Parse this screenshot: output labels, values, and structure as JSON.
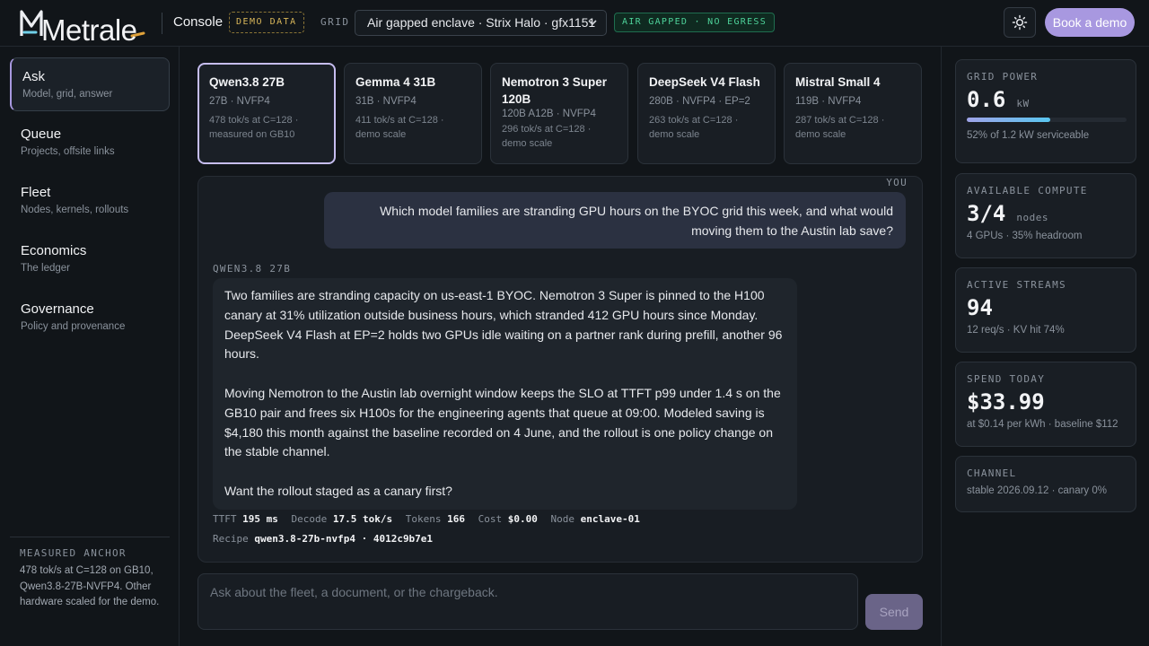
{
  "brand": {
    "name": "Metrale",
    "accent": "#a898e0"
  },
  "header": {
    "console_label": "Console",
    "demo_badge": "DEMO DATA",
    "grid_label": "GRID",
    "grid_selected": "Air gapped enclave · Strix Halo · gfx1151",
    "airgap_badge": "AIR GAPPED · NO EGRESS",
    "book_demo": "Book a demo",
    "theme_icon": "sun-icon"
  },
  "nav": {
    "items": [
      {
        "title": "Ask",
        "sub": "Model, grid, answer",
        "active": true
      },
      {
        "title": "Queue",
        "sub": "Projects, offsite links"
      },
      {
        "title": "Fleet",
        "sub": "Nodes, kernels, rollouts"
      },
      {
        "title": "Economics",
        "sub": "The ledger"
      },
      {
        "title": "Governance",
        "sub": "Policy and provenance"
      }
    ],
    "anchor": {
      "title": "MEASURED ANCHOR",
      "text": "478 tok/s at C=128 on GB10, Qwen3.8-27B-NVFP4. Other hardware scaled for the demo."
    }
  },
  "models": [
    {
      "name": "Qwen3.8 27B",
      "spec": "27B · NVFP4",
      "rate": "478 tok/s at C=128 · measured on GB10",
      "selected": true
    },
    {
      "name": "Gemma 4 31B",
      "spec": "31B · NVFP4",
      "rate": "411 tok/s at C=128 · demo scale"
    },
    {
      "name": "Nemotron 3 Super 120B",
      "spec": "120B A12B · NVFP4",
      "rate": "296 tok/s at C=128 · demo scale"
    },
    {
      "name": "DeepSeek V4 Flash",
      "spec": "280B · NVFP4 · EP=2",
      "rate": "263 tok/s at C=128 · demo scale"
    },
    {
      "name": "Mistral Small 4",
      "spec": "119B · NVFP4",
      "rate": "287 tok/s at C=128 · demo scale"
    }
  ],
  "chat": {
    "you_label": "YOU",
    "user_message": "Which model families are stranding GPU hours on the BYOC grid this week, and what would moving them to the Austin lab save?",
    "model_label": "QWEN3.8 27B",
    "answer": [
      "Two families are stranding capacity on us-east-1 BYOC. Nemotron 3 Super is pinned to the H100 canary at 31% utilization outside business hours, which stranded 412 GPU hours since Monday. DeepSeek V4 Flash at EP=2 holds two GPUs idle waiting on a partner rank during prefill, another 96 hours.",
      "Moving Nemotron to the Austin lab overnight window keeps the SLO at TTFT p99 under 1.4 s on the GB10 pair and frees six H100s for the engineering agents that queue at 09:00. Modeled saving is $4,180 this month against the baseline recorded on 4 June, and the rollout is one policy change on the stable channel.",
      "Want the rollout staged as a canary first?"
    ],
    "metrics": {
      "ttft_label": "TTFT",
      "ttft": "195 ms",
      "decode_label": "Decode",
      "decode": "17.5 tok/s",
      "tokens_label": "Tokens",
      "tokens": "166",
      "cost_label": "Cost",
      "cost": "$0.00",
      "node_label": "Node",
      "node": "enclave-01",
      "recipe_label": "Recipe",
      "recipe": "qwen3.8-27b-nvfp4 · 4012c9b7e1"
    }
  },
  "composer": {
    "placeholder": "Ask about the fleet, a document, or the chargeback.",
    "send_label": "Send"
  },
  "stats": {
    "power": {
      "title": "GRID POWER",
      "value": "0.6",
      "unit": "kW",
      "sub": "52% of 1.2 kW serviceable",
      "fraction": 0.52
    },
    "compute": {
      "title": "AVAILABLE COMPUTE",
      "value": "3/4",
      "unit": "nodes",
      "sub": "4 GPUs · 35% headroom"
    },
    "streams": {
      "title": "ACTIVE STREAMS",
      "value": "94",
      "sub": "12 req/s · KV hit 74%"
    },
    "spend": {
      "title": "SPEND TODAY",
      "value": "$33.99",
      "sub": "at $0.14 per kWh · baseline $112"
    },
    "channel": {
      "title": "CHANNEL",
      "sub": "stable 2026.09.12 · canary 0%"
    }
  }
}
